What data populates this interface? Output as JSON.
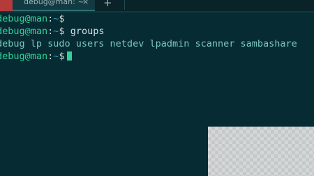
{
  "tab": {
    "title": "debug@man: ~",
    "close_glyph": "×",
    "new_tab_glyph": "+"
  },
  "terminal": {
    "prompt_user": "debug@man",
    "prompt_sep": ":",
    "prompt_path": "~",
    "prompt_symbol": "$",
    "lines": [
      {
        "kind": "prompt",
        "command": ""
      },
      {
        "kind": "prompt",
        "command": "groups"
      },
      {
        "kind": "output",
        "text": "debug lp sudo users netdev lpadmin scanner sambashare"
      },
      {
        "kind": "prompt",
        "command": "",
        "cursor": true
      }
    ]
  },
  "colors": {
    "background": "#072b32",
    "prompt_user": "#2fd39a",
    "prompt_path": "#2aa6c9",
    "output": "#79c7c1",
    "cursor": "#2fd39a",
    "tab_accent": "#b53a3a"
  }
}
